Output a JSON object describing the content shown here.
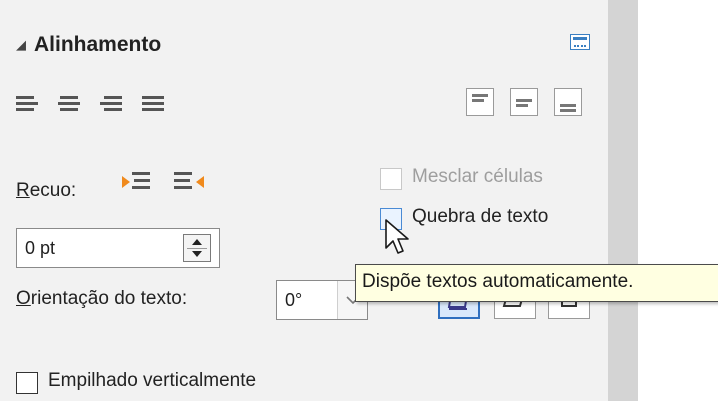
{
  "section": {
    "title": "Alinhamento",
    "collapse_icon": "triangle-down-icon",
    "more_icon": "more-options-icon"
  },
  "horizontal_alignment": {
    "icons": [
      "align-left-icon",
      "align-center-icon",
      "align-right-icon",
      "align-justify-icon"
    ]
  },
  "vertical_alignment": {
    "icons": [
      "align-top-icon",
      "align-middle-icon",
      "align-bottom-icon"
    ]
  },
  "indent": {
    "label_prefix": "",
    "label_mnemonic": "R",
    "label_rest": "ecuo:",
    "increase_icon": "increase-indent-icon",
    "decrease_icon": "decrease-indent-icon",
    "value": "0 pt"
  },
  "merge_cells": {
    "label": "Mesclar células",
    "checked": false,
    "enabled": false
  },
  "wrap_text": {
    "label": "Quebra de texto",
    "checked": false
  },
  "text_orientation": {
    "label_mnemonic": "O",
    "label_rest": "rientação do texto:",
    "value": "0°",
    "options_icons": [
      "orientation-horizontal-icon",
      "orientation-slanted-icon",
      "orientation-vertical-icon"
    ]
  },
  "stacked_vertically": {
    "label": "Empilhado verticalmente",
    "checked": false
  },
  "tooltip": {
    "text": "Dispõe textos automaticamente."
  },
  "colors": {
    "panel_bg": "#f2f2f2",
    "accent": "#2f6fbf",
    "tooltip_bg": "#ffffe1"
  }
}
